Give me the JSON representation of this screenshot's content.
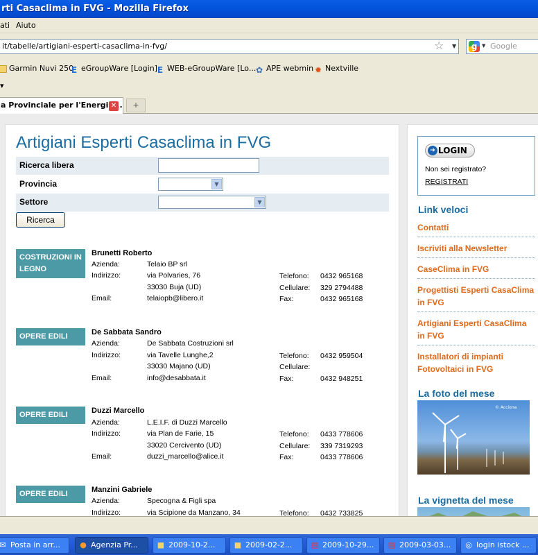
{
  "window": {
    "title": "rti Casaclima in FVG - Mozilla Firefox"
  },
  "menu": [
    "ati",
    "Aiuto"
  ],
  "navigation": {
    "url": "it/tabelle/artigiani-esperti-casaclima-in-fvg/",
    "search_placeholder": "Google"
  },
  "bookmarks": [
    {
      "label": "Garmin Nuvi 250",
      "icon": "folder-icon"
    },
    {
      "label": "eGroupWare [Login]",
      "icon": "egroupware-icon"
    },
    {
      "label": "WEB-eGroupWare [Lo...",
      "icon": "egroupware-icon"
    },
    {
      "label": "APE webmin",
      "icon": "webmin-icon"
    },
    {
      "label": "Nextville",
      "icon": "sun-icon"
    }
  ],
  "tabs": [
    {
      "label": "a Provinciale per l'Energia:..."
    }
  ],
  "page": {
    "title": "Artigiani Esperti Casaclima in FVG",
    "form": {
      "free_search_label": "Ricerca libera",
      "province_label": "Provincia",
      "sector_label": "Settore",
      "search_button": "Ricerca"
    },
    "field_labels": {
      "company": "Azienda:",
      "address": "Indirizzo:",
      "email": "Email:",
      "phone": "Telefono:",
      "mobile": "Cellulare:",
      "fax": "Fax:"
    },
    "entries": [
      {
        "category": "COSTRUZIONI IN LEGNO",
        "name": "Brunetti Roberto",
        "company": "Telaio BP srl",
        "address1": "via Polvaries, 76",
        "address2": "33030 Buja (UD)",
        "email": "telaiopb@libero.it",
        "phone": "0432 965168",
        "mobile": "329 2794488",
        "fax": "0432 965168"
      },
      {
        "category": "OPERE EDILI",
        "name": "De Sabbata Sandro",
        "company": "De Sabbata Costruzioni srl",
        "address1": "via Tavelle Lunghe,2",
        "address2": "33030 Majano (UD)",
        "email": "info@desabbata.it",
        "phone": "0432 959504",
        "mobile": "",
        "fax": "0432 948251"
      },
      {
        "category": "OPERE EDILI",
        "name": "Duzzi Marcello",
        "company": "L.E.I.F. di Duzzi Marcello",
        "address1": "via Plan de Farie, 15",
        "address2": "33020 Cercivento (UD)",
        "email": "duzzi_marcello@alice.it",
        "phone": "0433 778606",
        "mobile": "339 7319293",
        "fax": "0433 778606"
      },
      {
        "category": "OPERE EDILI",
        "name": "Manzini Gabriele",
        "company": "Specogna & Figli spa",
        "address1": "via Scipione da Manzano, 34",
        "address2": "",
        "email": "",
        "phone": "0432 733825",
        "mobile": "",
        "fax": ""
      }
    ]
  },
  "sidebar": {
    "login_button": "LOGIN",
    "not_registered": "Non sei registrato?",
    "register_link": "REGISTRATI",
    "quick_links_heading": "Link veloci",
    "quick_links": [
      "Contatti",
      "Iscriviti alla Newsletter",
      "CaseClima in FVG",
      "Progettisti Esperti CasaClima in FVG",
      "Artigiani Esperti CasaClima in FVG",
      "Installatori di impianti Fotovoltaici in FVG"
    ],
    "photo_heading": "La foto del mese",
    "photo_credit": "© Acciona",
    "vignette_heading": "La vignetta del mese"
  },
  "taskbar": [
    {
      "label": "Posta in arr...",
      "icon": "mail-icon"
    },
    {
      "label": "Agenzia Pr...",
      "icon": "firefox-icon",
      "active": true
    },
    {
      "label": "2009-10-2...",
      "icon": "folder-icon"
    },
    {
      "label": "2009-02-2...",
      "icon": "folder-icon"
    },
    {
      "label": "2009-10-29...",
      "icon": "pdf-icon"
    },
    {
      "label": "2009-03-03...",
      "icon": "pdf-icon"
    },
    {
      "label": "login istock ...",
      "icon": "browser-icon"
    }
  ]
}
